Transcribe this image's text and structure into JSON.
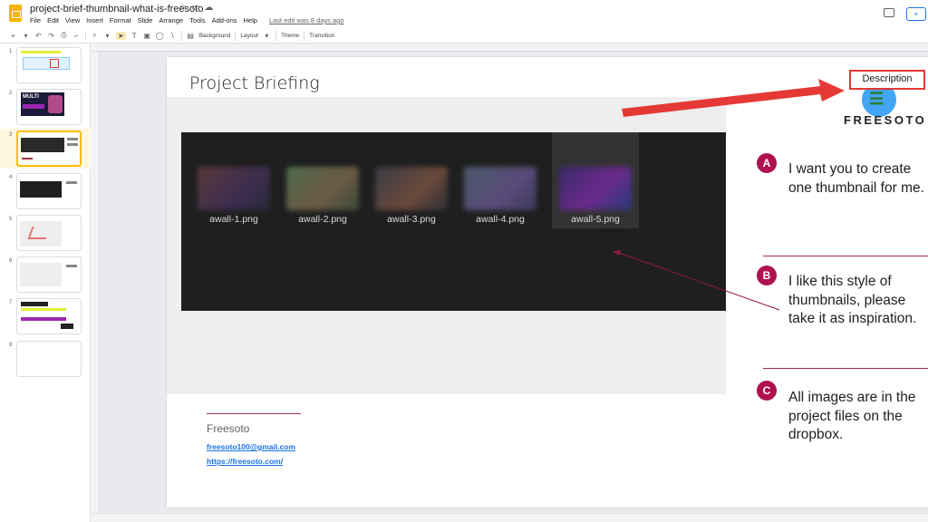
{
  "app": {
    "doc_title": "project-brief-thumbnail-what-is-freesoto",
    "menu": [
      "File",
      "Edit",
      "View",
      "Insert",
      "Format",
      "Slide",
      "Arrange",
      "Tools",
      "Add-ons",
      "Help"
    ],
    "last_edit": "Last edit was 8 days ago"
  },
  "toolbar": {
    "background_label": "Background",
    "layout_label": "Layout",
    "theme_label": "Theme",
    "transition_label": "Transition"
  },
  "filmstrip": {
    "slides": [
      "1",
      "2",
      "3",
      "4",
      "5",
      "6",
      "7",
      "8"
    ],
    "active_index": 2,
    "slide2_word": "MULTI"
  },
  "slide": {
    "title": "Project Briefing",
    "description_label": "Description",
    "logo_text": "FREESOTO",
    "files": [
      "awall-1.png",
      "awall-2.png",
      "awall-3.png",
      "awall-4.png",
      "awall-5.png"
    ],
    "selected_file_index": 4,
    "points": [
      {
        "badge": "A",
        "text": "I want you to create one thumbnail for me."
      },
      {
        "badge": "B",
        "text": "I like this style of thumbnails, please take it as inspiration."
      },
      {
        "badge": "C",
        "text": "All images are in the project files on the dropbox."
      }
    ],
    "footer": {
      "name": "Freesoto",
      "email": "freesoto100@gmail.com",
      "url": "https://freesoto.com/"
    }
  },
  "colors": {
    "accent_red": "#e53935",
    "badge": "#b0124f",
    "logo_blue": "#42a5f5",
    "logo_green": "#2e7d32",
    "active_thumb": "#fbbc04"
  }
}
